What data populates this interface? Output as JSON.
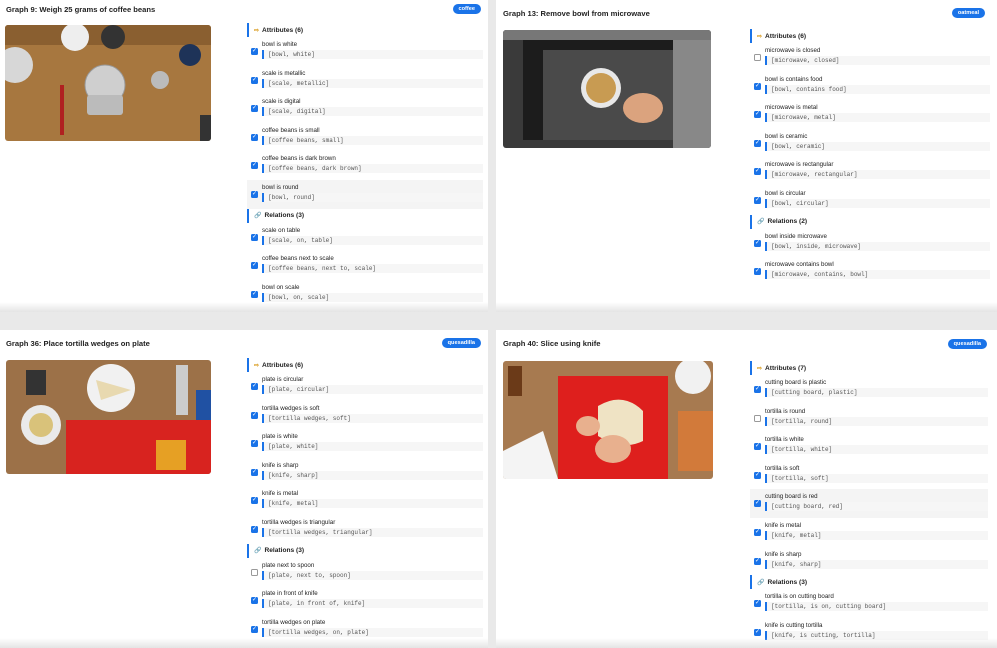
{
  "check_icon": "✓",
  "attr_icon": "⇨",
  "rel_icon": "🔗",
  "accent_color": "#1a73e8",
  "panels": [
    {
      "title": "Graph 9: Weigh 25 grams of coffee beans",
      "badge": "coffee",
      "attributes_label": "Attributes (6)",
      "attributes": [
        {
          "label": "bowl is white",
          "code": "[bowl, white]",
          "checked": true
        },
        {
          "label": "scale is metallic",
          "code": "[scale, metallic]",
          "checked": true
        },
        {
          "label": "scale is digital",
          "code": "[scale, digital]",
          "checked": true
        },
        {
          "label": "coffee beans is small",
          "code": "[coffee beans, small]",
          "checked": true
        },
        {
          "label": "coffee beans is dark brown",
          "code": "[coffee beans, dark brown]",
          "checked": true
        },
        {
          "label": "bowl is round",
          "code": "[bowl, round]",
          "checked": true
        }
      ],
      "relations_label": "Relations (3)",
      "relations": [
        {
          "label": "scale on table",
          "code": "[scale, on, table]",
          "checked": true
        },
        {
          "label": "coffee beans next to scale",
          "code": "[coffee beans, next to, scale]",
          "checked": true
        },
        {
          "label": "bowl on scale",
          "code": "[bowl, on, scale]",
          "checked": true
        }
      ]
    },
    {
      "title": "Graph 13: Remove bowl from microwave",
      "badge": "oatmeal",
      "attributes_label": "Attributes (6)",
      "attributes": [
        {
          "label": "microwave is closed",
          "code": "[microwave, closed]",
          "checked": false
        },
        {
          "label": "bowl is contains food",
          "code": "[bowl, contains food]",
          "checked": true
        },
        {
          "label": "microwave is metal",
          "code": "[microwave, metal]",
          "checked": true
        },
        {
          "label": "bowl is ceramic",
          "code": "[bowl, ceramic]",
          "checked": true
        },
        {
          "label": "microwave is rectangular",
          "code": "[microwave, rectangular]",
          "checked": true
        },
        {
          "label": "bowl is circular",
          "code": "[bowl, circular]",
          "checked": true
        }
      ],
      "relations_label": "Relations (2)",
      "relations": [
        {
          "label": "bowl inside microwave",
          "code": "[bowl, inside, microwave]",
          "checked": true
        },
        {
          "label": "microwave contains bowl",
          "code": "[microwave, contains, bowl]",
          "checked": true
        }
      ]
    },
    {
      "title": "Graph 36: Place tortilla wedges on plate",
      "badge": "quesadilla",
      "attributes_label": "Attributes (6)",
      "attributes": [
        {
          "label": "plate is circular",
          "code": "[plate, circular]",
          "checked": true
        },
        {
          "label": "tortilla wedges is soft",
          "code": "[tortilla wedges, soft]",
          "checked": true
        },
        {
          "label": "plate is white",
          "code": "[plate, white]",
          "checked": true
        },
        {
          "label": "knife is sharp",
          "code": "[knife, sharp]",
          "checked": true
        },
        {
          "label": "knife is metal",
          "code": "[knife, metal]",
          "checked": true
        },
        {
          "label": "tortilla wedges is triangular",
          "code": "[tortilla wedges, triangular]",
          "checked": true
        }
      ],
      "relations_label": "Relations (3)",
      "relations": [
        {
          "label": "plate next to spoon",
          "code": "[plate, next to, spoon]",
          "checked": false
        },
        {
          "label": "plate in front of knife",
          "code": "[plate, in front of, knife]",
          "checked": true
        },
        {
          "label": "tortilla wedges on plate",
          "code": "[tortilla wedges, on, plate]",
          "checked": true
        }
      ]
    },
    {
      "title": "Graph 40: Slice using knife",
      "badge": "quesadilla",
      "attributes_label": "Attributes (7)",
      "attributes": [
        {
          "label": "cutting board is plastic",
          "code": "[cutting board, plastic]",
          "checked": true
        },
        {
          "label": "tortilla is round",
          "code": "[tortilla, round]",
          "checked": false
        },
        {
          "label": "tortilla is white",
          "code": "[tortilla, white]",
          "checked": true
        },
        {
          "label": "tortilla is soft",
          "code": "[tortilla, soft]",
          "checked": true
        },
        {
          "label": "cutting board is red",
          "code": "[cutting board, red]",
          "checked": true
        },
        {
          "label": "knife is metal",
          "code": "[knife, metal]",
          "checked": true
        },
        {
          "label": "knife is sharp",
          "code": "[knife, sharp]",
          "checked": true
        }
      ],
      "relations_label": "Relations (3)",
      "relations": [
        {
          "label": "tortilla is on cutting board",
          "code": "[tortilla, is on, cutting board]",
          "checked": true
        },
        {
          "label": "knife is cutting tortilla",
          "code": "[knife, is cutting, tortilla]",
          "checked": true
        }
      ]
    }
  ]
}
